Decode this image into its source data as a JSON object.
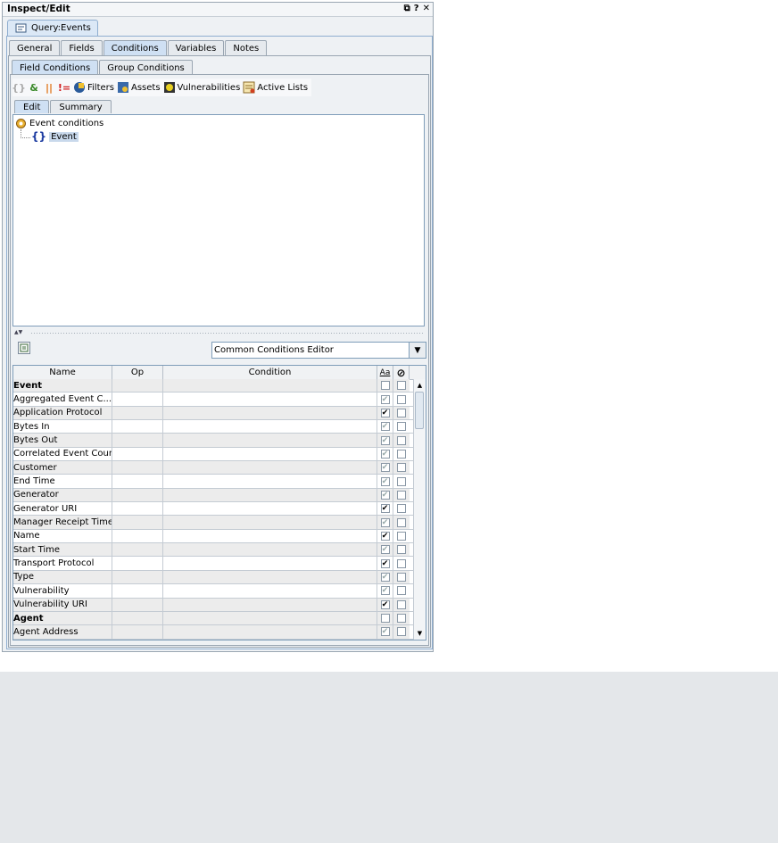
{
  "window": {
    "title": "Inspect/Edit",
    "controls": [
      "⧉",
      "?",
      "✕"
    ]
  },
  "doc_tab": {
    "label": "Query:Events"
  },
  "main_tabs": [
    "General",
    "Fields",
    "Conditions",
    "Variables",
    "Notes"
  ],
  "sub_tabs": [
    "Field Conditions",
    "Group Conditions"
  ],
  "toolbar": {
    "filters": "Filters",
    "assets": "Assets",
    "vulnerabilities": "Vulnerabilities",
    "active_lists": "Active Lists"
  },
  "edit_tabs": [
    "Edit",
    "Summary"
  ],
  "tree": {
    "root": "Event conditions",
    "child": "Event"
  },
  "editor": {
    "selected": "Common Conditions Editor"
  },
  "table": {
    "headers": {
      "name": "Name",
      "op": "Op",
      "condition": "Condition",
      "case": "Aa",
      "not": "⊘"
    },
    "rows": [
      {
        "name": "Event",
        "group": true,
        "case": "",
        "not": ""
      },
      {
        "name": "Aggregated Event C...",
        "case": "✔",
        "case_dark": false
      },
      {
        "name": "Application Protocol",
        "case": "✔",
        "case_dark": true
      },
      {
        "name": "Bytes In",
        "case": "✔",
        "case_dark": false
      },
      {
        "name": "Bytes Out",
        "case": "✔",
        "case_dark": false
      },
      {
        "name": "Correlated Event Count",
        "case": "✔",
        "case_dark": false
      },
      {
        "name": "Customer",
        "case": "✔",
        "case_dark": false
      },
      {
        "name": "End Time",
        "case": "✔",
        "case_dark": false
      },
      {
        "name": "Generator",
        "case": "✔",
        "case_dark": false
      },
      {
        "name": "Generator URI",
        "case": "✔",
        "case_dark": true
      },
      {
        "name": "Manager Receipt Time",
        "case": "✔",
        "case_dark": false
      },
      {
        "name": "Name",
        "case": "✔",
        "case_dark": true
      },
      {
        "name": "Start Time",
        "case": "✔",
        "case_dark": false
      },
      {
        "name": "Transport Protocol",
        "case": "✔",
        "case_dark": true
      },
      {
        "name": "Type",
        "case": "✔",
        "case_dark": false
      },
      {
        "name": "Vulnerability",
        "case": "✔",
        "case_dark": false
      },
      {
        "name": "Vulnerability URI",
        "case": "✔",
        "case_dark": true
      },
      {
        "name": "Agent",
        "group": true,
        "case": "",
        "not": ""
      },
      {
        "name": "Agent Address",
        "case": "✔",
        "case_dark": false
      }
    ]
  }
}
